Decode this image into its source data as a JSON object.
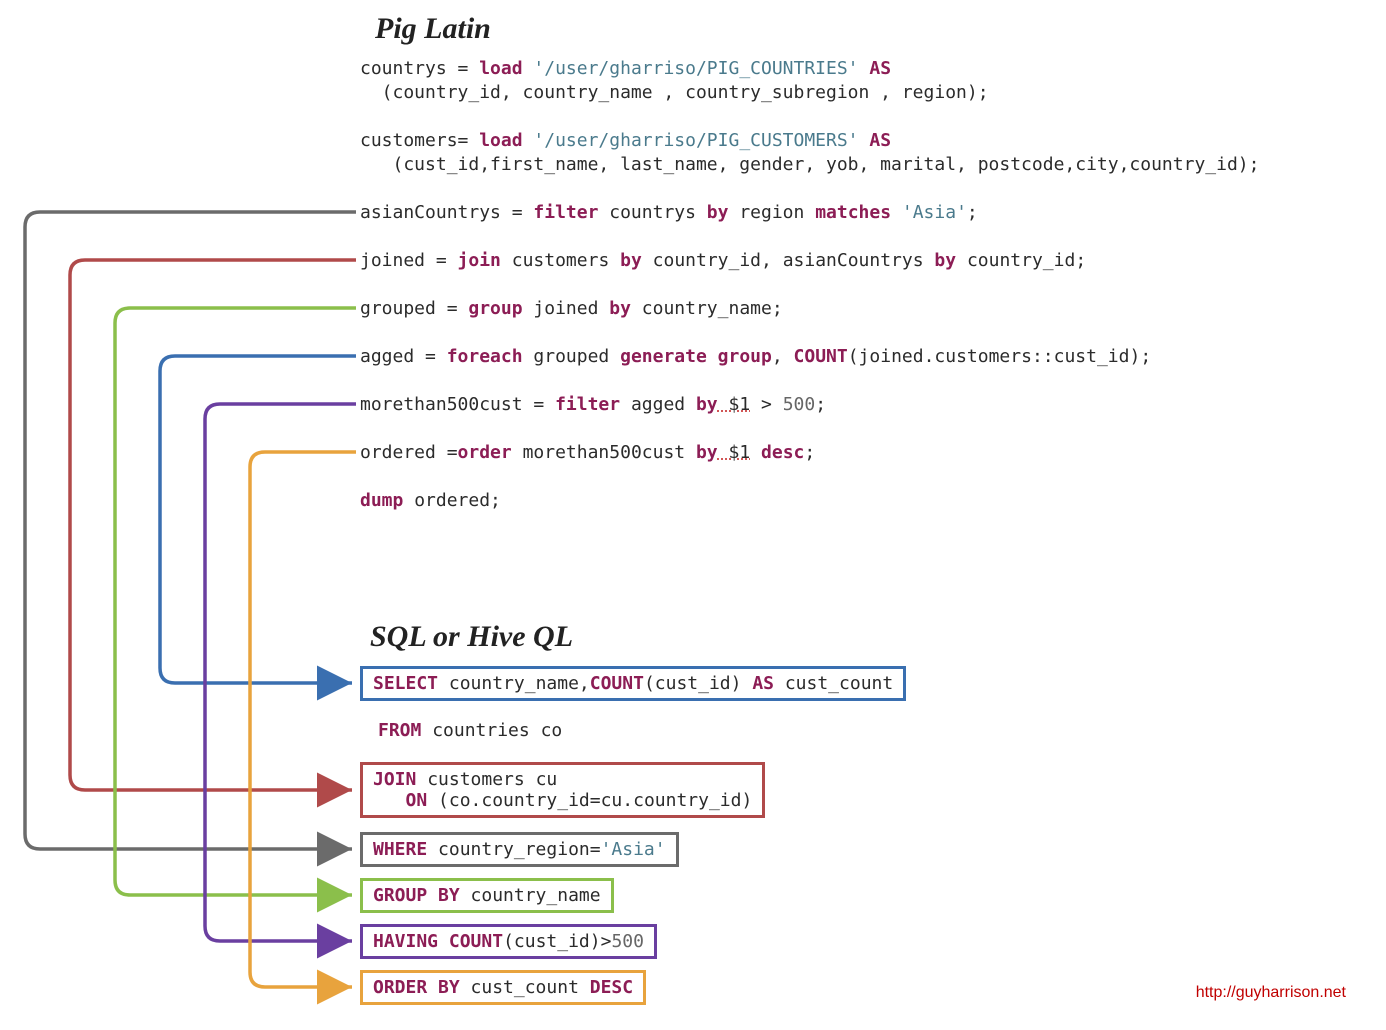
{
  "headings": {
    "pig": "Pig Latin",
    "sql": "SQL or Hive QL"
  },
  "pig": {
    "l1a": "countrys = ",
    "l1b": "load",
    "l1c": " '/user/gharriso/PIG_COUNTRIES' ",
    "l1d": "AS",
    "l2": "  (country_id, country_name , country_subregion , region);",
    "l3a": "customers= ",
    "l3b": "load",
    "l3c": " '/user/gharriso/PIG_CUSTOMERS' ",
    "l3d": "AS",
    "l4": "   (cust_id,first_name, last_name, gender, yob, marital, postcode,city,country_id);",
    "l5a": "asianCountrys = ",
    "l5b": "filter",
    "l5c": " countrys ",
    "l5d": "by",
    "l5e": " region ",
    "l5f": "matches",
    "l5g": " 'Asia'",
    "l5h": ";",
    "l6a": "joined = ",
    "l6b": "join",
    "l6c": " customers ",
    "l6d": "by",
    "l6e": " country_id, asianCountrys ",
    "l6f": "by",
    "l6g": " country_id;",
    "l7a": "grouped = ",
    "l7b": "group",
    "l7c": " joined ",
    "l7d": "by",
    "l7e": " country_name;",
    "l8a": "agged = ",
    "l8b": "foreach",
    "l8c": " grouped ",
    "l8d": "generate",
    "l8e": " ",
    "l8f": "group",
    "l8g": ", ",
    "l8h": "COUNT",
    "l8i": "(joined.customers::cust_id);",
    "l9a": "morethan500cust = ",
    "l9b": "filter",
    "l9c": " agged ",
    "l9d": "by",
    "l9e": " $1",
    "l9f": " > ",
    "l9g": "500",
    "l9h": ";",
    "l10a": "ordered =",
    "l10b": "order",
    "l10c": " morethan500cust ",
    "l10d": "by",
    "l10e": " $1",
    "l10f": " ",
    "l10g": "desc",
    "l10h": ";",
    "l11a": "dump",
    "l11b": " ordered;"
  },
  "sql": {
    "select_a": "SELECT",
    "select_b": " country_name,",
    "select_c": "COUNT",
    "select_d": "(cust_id) ",
    "select_e": "AS",
    "select_f": " cust_count",
    "from_a": "FROM",
    "from_b": " countries co",
    "join_a": "JOIN",
    "join_b": " customers cu",
    "join_c": "   ",
    "join_d": "ON",
    "join_e": " (co.country_id=cu.country_id)",
    "where_a": "WHERE",
    "where_b": " country_region=",
    "where_c": "'Asia'",
    "group_a": "GROUP BY",
    "group_b": " country_name",
    "having_a": "HAVING",
    "having_b": " ",
    "having_c": "COUNT",
    "having_d": "(cust_id)>",
    "having_e": "500",
    "order_a": "ORDER BY",
    "order_b": " cust_count ",
    "order_c": "DESC"
  },
  "colors": {
    "blue": "#3a6fb0",
    "red": "#b04a4a",
    "gray": "#6b6b6b",
    "green": "#8bbf4b",
    "purple": "#6a3fa0",
    "orange": "#e8a33d"
  },
  "footer": "http://guyharrison.net"
}
